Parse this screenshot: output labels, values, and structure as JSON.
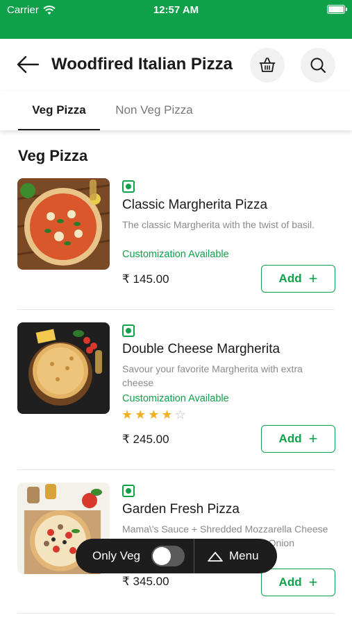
{
  "status_bar": {
    "carrier": "Carrier",
    "time": "12:57 AM",
    "wifi_icon": "wifi-icon",
    "battery_icon": "battery-icon"
  },
  "header": {
    "title": "Woodfired Italian Pizza",
    "back_icon": "back-arrow-icon",
    "basket_icon": "basket-icon",
    "search_icon": "search-icon"
  },
  "tabs": [
    {
      "label": "Veg Pizza",
      "active": true
    },
    {
      "label": "Non Veg Pizza",
      "active": false
    }
  ],
  "section": {
    "title": "Veg Pizza"
  },
  "items": [
    {
      "name": "Classic Margherita Pizza",
      "description": "The classic Margherita with the twist of basil.",
      "customization": "Customization Available",
      "price": "₹ 145.00",
      "add_label": "Add",
      "veg": true
    },
    {
      "name": "Double Cheese Margherita",
      "description": "Savour your favorite Margherita with extra cheese",
      "customization": "Customization Available",
      "rating": 4,
      "rating_max": 5,
      "price": "₹ 245.00",
      "add_label": "Add",
      "veg": true
    },
    {
      "name": "Garden Fresh Pizza",
      "description": "Mama\\'s Sauce + Shredded Mozzarella Cheese + Tomato + Mushroom + Olives + Onion",
      "price": "₹ 345.00",
      "add_label": "Add",
      "veg": true
    }
  ],
  "floating_bar": {
    "only_veg_label": "Only Veg",
    "only_veg_enabled": false,
    "menu_label": "Menu",
    "menu_icon": "menu-book-icon"
  },
  "colors": {
    "brand_green": "#0fa14a",
    "star": "#f2b01e",
    "floating_bar_bg": "#1d1d1d"
  }
}
